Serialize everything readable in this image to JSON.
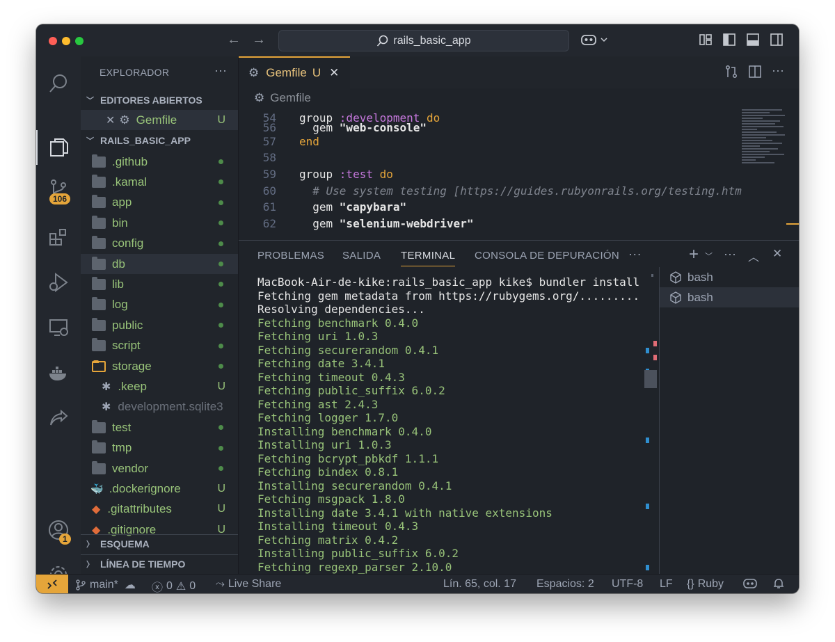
{
  "window": {
    "search_text": "rails_basic_app",
    "colors": {
      "accent": "#e5a53a",
      "git_green": "#98c379",
      "keyword": "#c678dd"
    }
  },
  "activity": {
    "scm_badge": "106",
    "account_badge": "1"
  },
  "sidebar": {
    "title": "EXPLORADOR",
    "more": "···",
    "open_editors_header": "EDITORES ABIERTOS",
    "open_editor": {
      "name": "Gemfile",
      "status": "U"
    },
    "project_header": "RAILS_BASIC_APP",
    "items": [
      {
        "label": ".github",
        "status": "dot"
      },
      {
        "label": ".kamal",
        "status": "dot"
      },
      {
        "label": "app",
        "status": "dot"
      },
      {
        "label": "bin",
        "status": "dot"
      },
      {
        "label": "config",
        "status": "dot"
      },
      {
        "label": "db",
        "status": "dot"
      },
      {
        "label": "lib",
        "status": "dot"
      },
      {
        "label": "log",
        "status": "dot"
      },
      {
        "label": "public",
        "status": "dot"
      },
      {
        "label": "script",
        "status": "dot"
      },
      {
        "label": "storage",
        "status": "dot"
      },
      {
        "label": ".keep",
        "status": "U"
      },
      {
        "label": "development.sqlite3",
        "status": ""
      },
      {
        "label": "test",
        "status": "dot"
      },
      {
        "label": "tmp",
        "status": "dot"
      },
      {
        "label": "vendor",
        "status": "dot"
      },
      {
        "label": ".dockerignore",
        "status": "U"
      },
      {
        "label": ".gitattributes",
        "status": "U"
      },
      {
        "label": ".gitignore",
        "status": "U"
      }
    ],
    "outline_header": "ESQUEMA",
    "timeline_header": "LÍNEA DE TIEMPO"
  },
  "editor": {
    "tab_name": "Gemfile",
    "tab_status": "U",
    "breadcrumb": "Gemfile",
    "lines": [
      {
        "num": "54",
        "parts": [
          [
            "plain",
            "group "
          ],
          [
            "sym",
            ":development"
          ],
          [
            "plain",
            " "
          ],
          [
            "do",
            "do"
          ]
        ]
      },
      {
        "num": "56",
        "parts": [
          [
            "plain",
            "  gem "
          ],
          [
            "str",
            "\"web-console\""
          ]
        ]
      },
      {
        "num": "57",
        "parts": [
          [
            "do",
            "end"
          ]
        ]
      },
      {
        "num": "58",
        "parts": []
      },
      {
        "num": "59",
        "parts": [
          [
            "plain",
            "group "
          ],
          [
            "sym",
            ":test"
          ],
          [
            "plain",
            " "
          ],
          [
            "do",
            "do"
          ]
        ]
      },
      {
        "num": "60",
        "parts": [
          [
            "cmt",
            "  # Use system testing [https://guides.rubyonrails.org/testing.htm"
          ]
        ]
      },
      {
        "num": "61",
        "parts": [
          [
            "plain",
            "  gem "
          ],
          [
            "str",
            "\"capybara\""
          ]
        ]
      },
      {
        "num": "62",
        "parts": [
          [
            "plain",
            "  gem "
          ],
          [
            "str",
            "\"selenium-webdriver\""
          ]
        ]
      }
    ]
  },
  "panel": {
    "tabs": [
      "PROBLEMAS",
      "SALIDA",
      "TERMINAL",
      "CONSOLA DE DEPURACIÓN"
    ],
    "more": "···",
    "terminal_lines": [
      {
        "c": "white",
        "t": "MacBook-Air-de-kike:rails_basic_app kike$ bundler install"
      },
      {
        "c": "white",
        "t": "Fetching gem metadata from https://rubygems.org/........."
      },
      {
        "c": "white",
        "t": "Resolving dependencies..."
      },
      {
        "c": "green",
        "t": "Fetching benchmark 0.4.0"
      },
      {
        "c": "green",
        "t": "Fetching uri 1.0.3"
      },
      {
        "c": "green",
        "t": "Fetching securerandom 0.4.1"
      },
      {
        "c": "green",
        "t": "Fetching date 3.4.1"
      },
      {
        "c": "green",
        "t": "Fetching timeout 0.4.3"
      },
      {
        "c": "green",
        "t": "Fetching public_suffix 6.0.2"
      },
      {
        "c": "green",
        "t": "Fetching ast 2.4.3"
      },
      {
        "c": "green",
        "t": "Fetching logger 1.7.0"
      },
      {
        "c": "green",
        "t": "Installing benchmark 0.4.0"
      },
      {
        "c": "green",
        "t": "Installing uri 1.0.3"
      },
      {
        "c": "green",
        "t": "Fetching bcrypt_pbkdf 1.1.1"
      },
      {
        "c": "green",
        "t": "Fetching bindex 0.8.1"
      },
      {
        "c": "green",
        "t": "Installing securerandom 0.4.1"
      },
      {
        "c": "green",
        "t": "Fetching msgpack 1.8.0"
      },
      {
        "c": "green",
        "t": "Installing date 3.4.1 with native extensions"
      },
      {
        "c": "green",
        "t": "Installing timeout 0.4.3"
      },
      {
        "c": "green",
        "t": "Fetching matrix 0.4.2"
      },
      {
        "c": "green",
        "t": "Installing public_suffix 6.0.2"
      },
      {
        "c": "green",
        "t": "Fetching regexp_parser 2.10.0"
      }
    ],
    "terminals": [
      "bash",
      "bash"
    ]
  },
  "statusbar": {
    "branch": "main*",
    "errors": "0",
    "warnings": "0",
    "live_share": "Live Share",
    "position": "Lín. 65, col. 17",
    "spaces": "Espacios: 2",
    "encoding": "UTF-8",
    "eol": "LF",
    "language": "Ruby"
  }
}
